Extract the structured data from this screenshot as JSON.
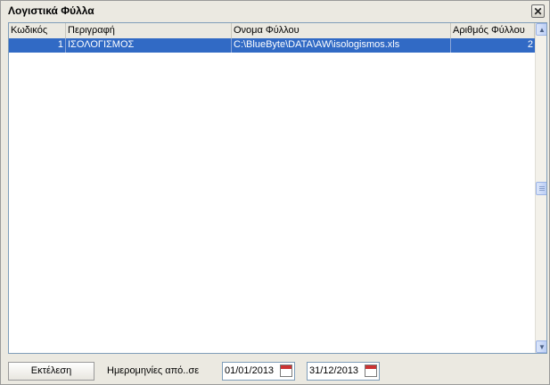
{
  "window": {
    "title": "Λογιστικά Φύλλα",
    "close_glyph": "✕"
  },
  "grid": {
    "columns": [
      "Κωδικός",
      "Περιγραφή",
      "Ονομα Φύλλου",
      "Αριθμός Φύλλου"
    ],
    "rows": [
      {
        "code": "1",
        "description": "ΙΣΟΛΟΓΙΣΜΟΣ",
        "file": "C:\\BlueByte\\DATA\\AW\\isologismos.xls",
        "sheet": "2",
        "selected": true
      }
    ]
  },
  "footer": {
    "execute_label": "Εκτέλεση",
    "dates_label": "Ημερομηνίες από..σε",
    "date_from": "01/01/2013",
    "date_to": "31/12/2013"
  },
  "icons": {
    "close": "close-icon",
    "calendar": "calendar-icon",
    "scroll_up": "scroll-up-icon",
    "scroll_down": "scroll-down-icon"
  },
  "colors": {
    "selection": "#316ac5",
    "window_bg": "#ebe9e1"
  }
}
